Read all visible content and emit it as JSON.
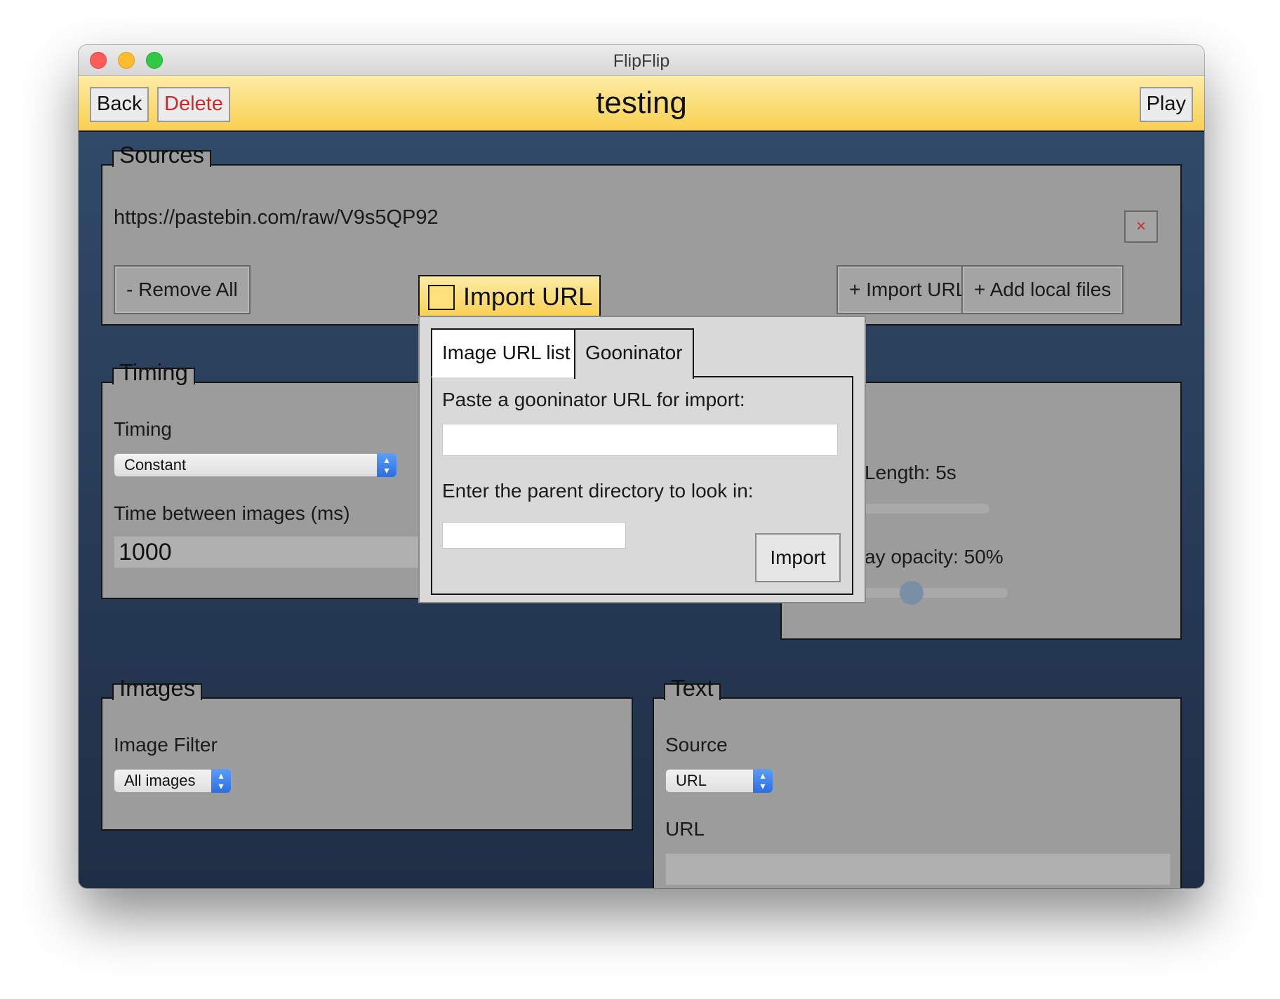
{
  "window": {
    "title": "FlipFlip"
  },
  "header": {
    "back": "Back",
    "delete": "Delete",
    "title": "testing",
    "play": "Play"
  },
  "sources": {
    "legend": "Sources",
    "url": "https://pastebin.com/raw/V9s5QP92",
    "remove_button": "×",
    "remove_all": "- Remove All",
    "import_url": "+ Import URL",
    "add_local_files": "+ Add local files"
  },
  "timing": {
    "legend": "Timing",
    "timing_label": "Timing",
    "timing_value": "Constant",
    "time_between_label": "Time between images (ms)",
    "time_between_value": "1000"
  },
  "effects": {
    "length_label": "Length: 5s",
    "opacity_label": "ay opacity: 50%",
    "opacity_value": 0.5
  },
  "images": {
    "legend": "Images",
    "filter_label": "Image Filter",
    "filter_value": "All images"
  },
  "text": {
    "legend": "Text",
    "source_label": "Source",
    "source_value": "URL",
    "url_label": "URL",
    "url_value": ""
  },
  "modal": {
    "title": "Import URL",
    "tabs": [
      {
        "label": "Image URL list"
      },
      {
        "label": "Gooninator"
      }
    ],
    "active_tab": "Gooninator",
    "paste_label": "Paste a gooninator URL for import:",
    "paste_value": "",
    "dir_label": "Enter the parent directory to look in:",
    "dir_value": "",
    "import_button": "Import"
  }
}
